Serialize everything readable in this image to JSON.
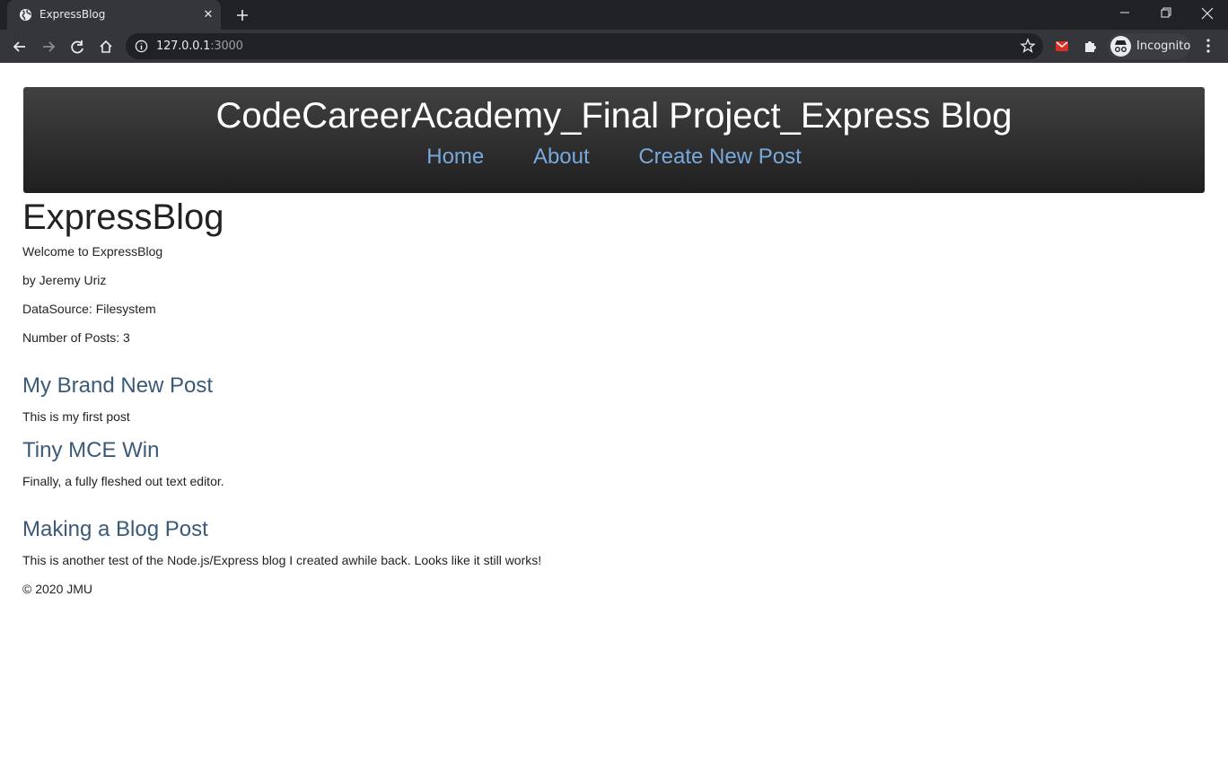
{
  "browser": {
    "tab_title": "ExpressBlog",
    "url_host": "127.0.0.1",
    "url_port": ":3000",
    "profile_label": "Incognito"
  },
  "site": {
    "header_title": "CodeCareerAcademy_Final Project_Express Blog",
    "nav": [
      "Home",
      "About",
      "Create New Post"
    ],
    "heading": "ExpressBlog",
    "welcome": "Welcome to ExpressBlog",
    "author": "by Jeremy Uriz",
    "datasource": "DataSource: Filesystem",
    "post_count": "Number of Posts: 3",
    "posts": [
      {
        "title": "My Brand New Post",
        "body": "This is my first post"
      },
      {
        "title": "Tiny MCE Win",
        "body": "Finally, a fully fleshed out text editor."
      },
      {
        "title": "Making a Blog Post",
        "body": "This is another test of the Node.js/Express blog I created awhile back. Looks like it still works!"
      }
    ],
    "footer": "© 2020 JMU"
  },
  "colors": {
    "chrome_dark": "#202124",
    "chrome_tab": "#35363a",
    "header_gradient_top": "#414141",
    "header_gradient_bottom": "#1f1f1f",
    "nav_link": "#79a9dc",
    "post_title": "#3a5a78"
  }
}
